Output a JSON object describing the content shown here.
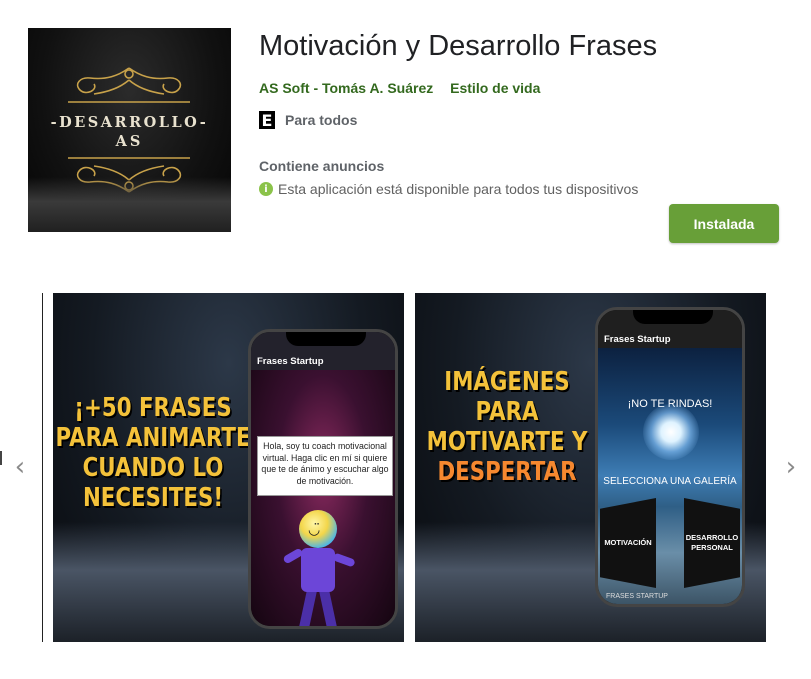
{
  "app": {
    "title": "Motivación y Desarrollo Frases",
    "developer": "AS Soft - Tomás A. Suárez",
    "category": "Estilo de vida",
    "content_rating_badge": "E",
    "content_rating_label": "Para todos",
    "ads_notice": "Contiene anuncios",
    "availability_icon": "info-icon",
    "availability_notice": "Esta aplicación está disponible para todos tus dispositivos",
    "install_button_label": "Instalada",
    "accent_color": "#689f38",
    "link_color": "#33691e"
  },
  "app_icon": {
    "line1": "-DESARROLLO-",
    "line2": "AS"
  },
  "carousel": {
    "prev_icon": "chevron-left-icon",
    "next_icon": "chevron-right-icon",
    "prev_glyph": "‹",
    "next_glyph": "›",
    "screenshots": [
      {
        "headline_lines": [
          "¡+50 FRASES",
          "PARA ANIMARTE",
          "CUANDO LO",
          "NECESITES!"
        ],
        "phone_header": "Frases Startup",
        "speech_text": "Hola, soy tu coach motivacional virtual. Haga clic en mí si quiere que te de ánimo y escuchar algo de motivación.",
        "mascot_face": "◡̈"
      },
      {
        "headline_lines": [
          "IMÁGENES",
          "PARA",
          "MOTIVARTE Y"
        ],
        "headline_highlight": "DESPERTAR",
        "phone_header": "Frases Startup",
        "banner_text": "¡NO TE RINDAS!",
        "gallery_prompt": "SELECCIONA UNA GALERÍA",
        "left_door": "MOTIVACIÓN",
        "right_door": "DESARROLLO PERSONAL",
        "footer_text": "FRASES STARTUP"
      }
    ]
  }
}
